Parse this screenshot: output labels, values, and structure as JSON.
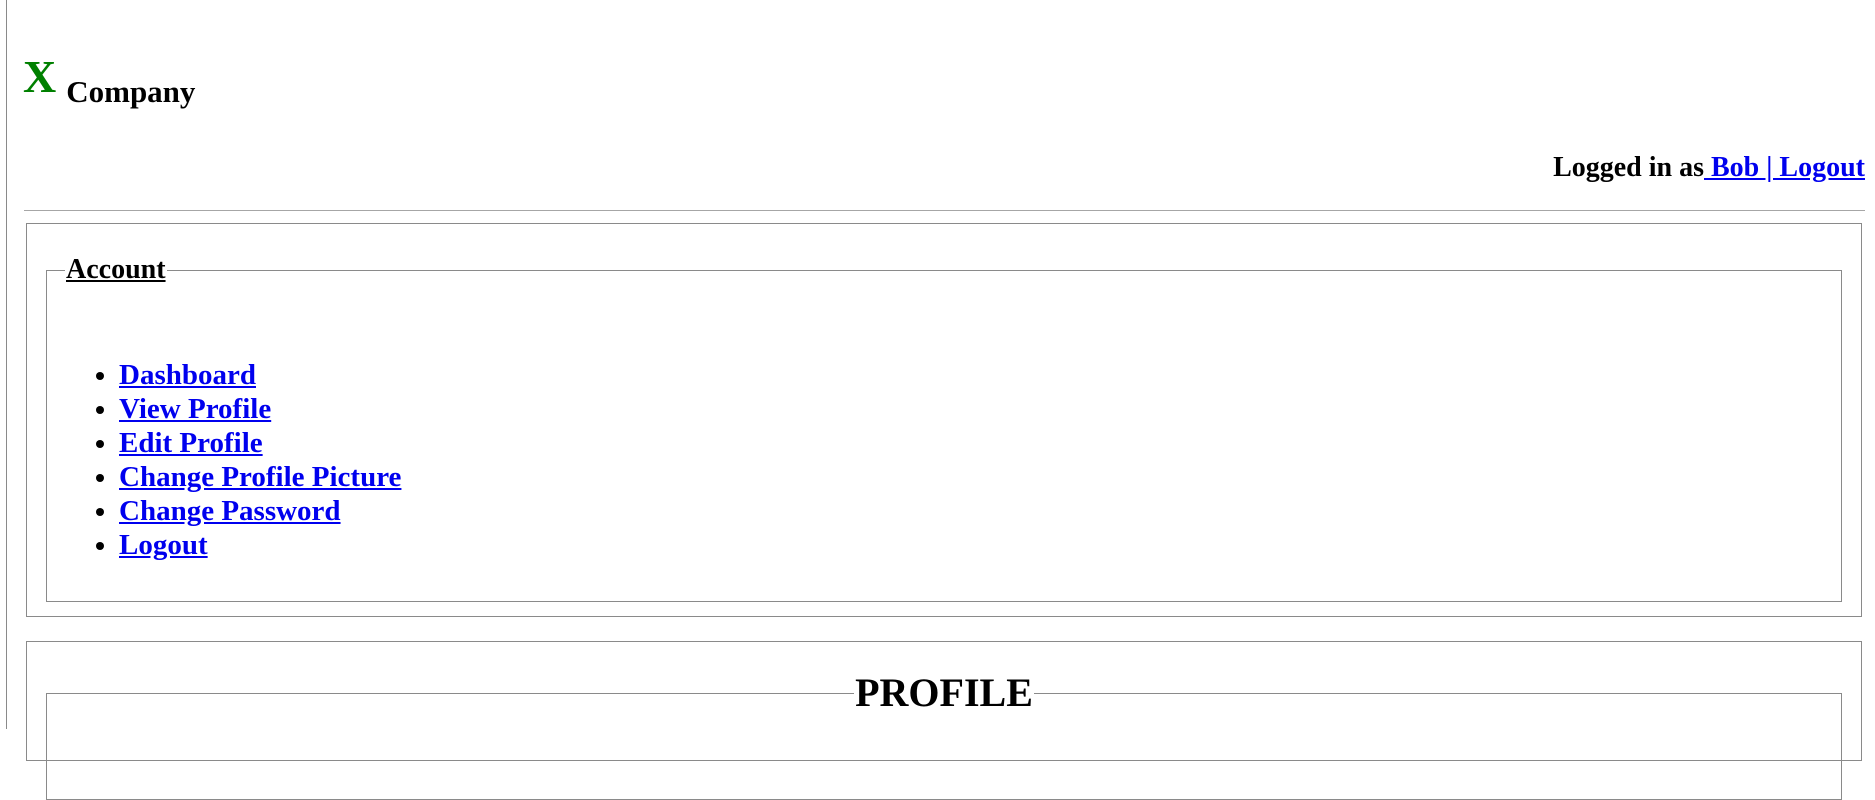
{
  "brand": {
    "mark": "X",
    "name": "Company",
    "mark_color": "#008000"
  },
  "login": {
    "prefix": "Logged in as",
    "link": " Bob | Logout",
    "link_color": "#0000ee"
  },
  "account": {
    "legend": "Account",
    "items": [
      {
        "label": "Dashboard"
      },
      {
        "label": "View Profile"
      },
      {
        "label": "Edit Profile"
      },
      {
        "label": "Change Profile Picture"
      },
      {
        "label": "Change Password"
      },
      {
        "label": "Logout"
      }
    ]
  },
  "profile": {
    "legend": "PROFILE"
  }
}
